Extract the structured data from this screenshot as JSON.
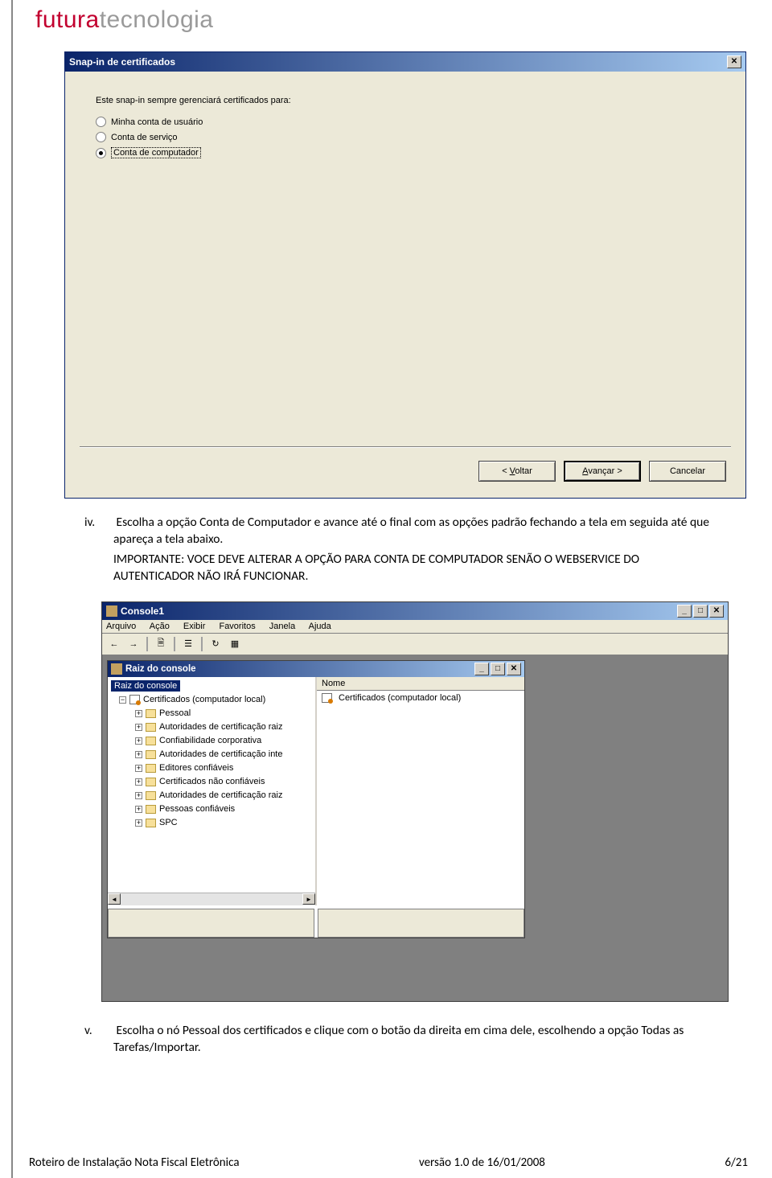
{
  "logo": {
    "part1": "futura",
    "part2": "tecnologia"
  },
  "dialog1": {
    "title": "Snap-in de certificados",
    "prompt": "Este snap-in sempre gerenciará certificados para:",
    "options": [
      {
        "label": "Minha conta de usuário",
        "selected": false
      },
      {
        "label": "Conta de serviço",
        "selected": false
      },
      {
        "label": "Conta de computador",
        "selected": true
      }
    ],
    "btn_back_prefix": "< ",
    "btn_back_u": "V",
    "btn_back_rest": "oltar",
    "btn_next_u": "A",
    "btn_next_rest": "vançar >",
    "btn_cancel": "Cancelar"
  },
  "para_iv_marker": "iv.",
  "para_iv": "Escolha a opção Conta de Computador e avance até o final com as opções padrão fechando a tela em seguida até que apareça a tela abaixo. IMPORTANTE: VOCE DEVE ALTERAR A OPÇÃO PARA CONTA DE COMPUTADOR SENÃO O WEBSERVICE DO AUTENTICADOR NÃO IRÁ FUNCIONAR.",
  "para_iv_warning": "IMPORTANTE: VOCE DEVE ALTERAR A OPÇÃO PARA CONTA DE COMPUTADOR SENÃO O WEBSERVICE DO AUTENTICADOR NÃO IRÁ FUNCIONAR.",
  "para_iv_main": "Escolha a opção Conta de Computador e avance até o final com as opções padrão fechando a tela em seguida até que apareça a tela abaixo.",
  "mmc": {
    "title": "Console1",
    "menu": [
      "Arquivo",
      "Ação",
      "Exibir",
      "Favoritos",
      "Janela",
      "Ajuda"
    ],
    "child_title": "Raiz do console",
    "tree_root": "Raiz do console",
    "tree_main": "Certificados (computador local)",
    "tree_children": [
      "Pessoal",
      "Autoridades de certificação raiz",
      "Confiabilidade corporativa",
      "Autoridades de certificação inte",
      "Editores confiáveis",
      "Certificados não confiáveis",
      "Autoridades de certificação raiz",
      "Pessoas confiáveis",
      "SPC"
    ],
    "list_header": "Nome",
    "list_item": "Certificados (computador local)"
  },
  "para_v_marker": "v.",
  "para_v": "Escolha o nó Pessoal dos certificados e clique com o botão da direita em cima dele, escolhendo a opção Todas as Tarefas/Importar.",
  "footer": {
    "left": "Roteiro de Instalação Nota Fiscal Eletrônica",
    "mid": "versão 1.0 de 16/01/2008",
    "right": "6/21"
  }
}
